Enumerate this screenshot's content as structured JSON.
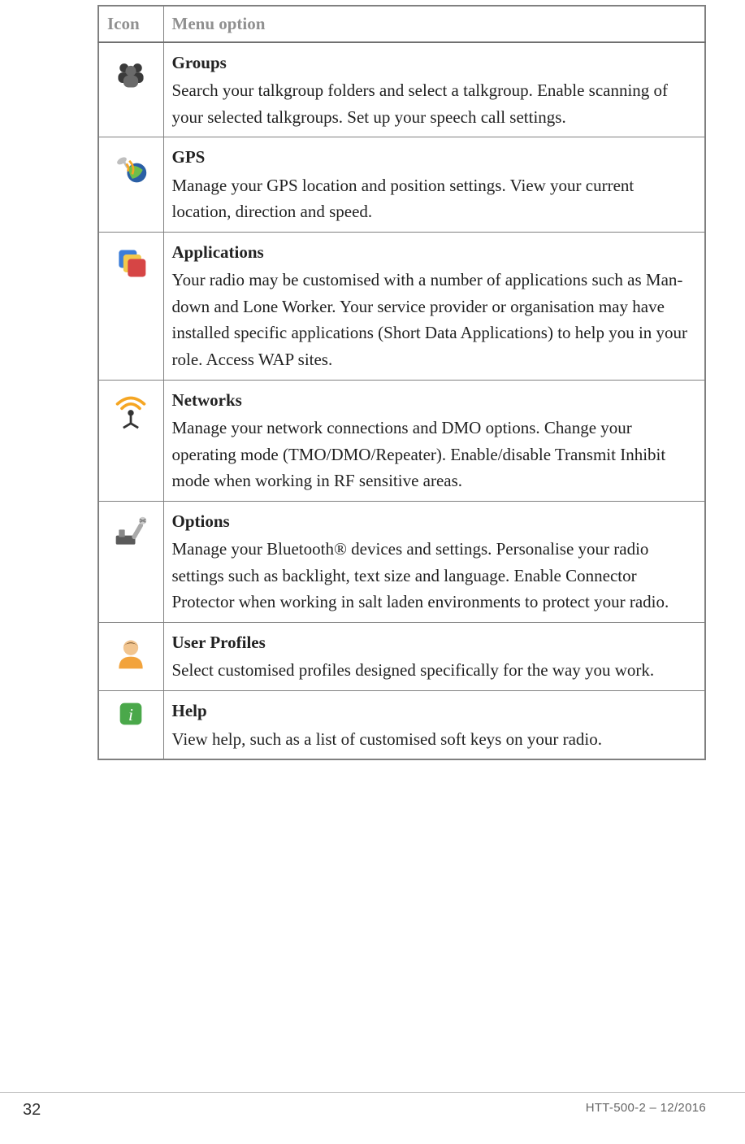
{
  "table": {
    "headers": {
      "icon": "Icon",
      "menu": "Menu option"
    },
    "rows": [
      {
        "icon": "groups-icon",
        "title": "Groups",
        "desc": "Search your talkgroup folders and select a talkgroup. Enable scanning of your selected talkgroups. Set up your speech call settings."
      },
      {
        "icon": "gps-icon",
        "title": "GPS",
        "desc": "Manage your GPS location and position settings. View your current location, direction and speed."
      },
      {
        "icon": "applications-icon",
        "title": "Applications",
        "desc": "Your radio may be customised with a number of applications such as Man-down and Lone Worker. Your service provider or organisation may have installed specific applications (Short Data Applications) to help you in your role. Access WAP sites."
      },
      {
        "icon": "networks-icon",
        "title": "Networks",
        "desc": "Manage your network connections and DMO options. Change your operating mode (TMO/DMO/Repeater). Enable/disable Transmit Inhibit mode when working in RF sensitive areas."
      },
      {
        "icon": "options-icon",
        "title": "Options",
        "desc": "Manage your Bluetooth® devices and settings. Personalise your radio settings such as backlight, text size and language. Enable Connector Protector when working in salt laden environments to protect your radio."
      },
      {
        "icon": "user-profiles-icon",
        "title": "User Profiles",
        "desc": "Select customised profiles designed specifically for the way you work."
      },
      {
        "icon": "help-icon",
        "title": "Help",
        "desc": "View help, such as a list of customised soft keys on your radio."
      }
    ]
  },
  "footer": {
    "page_number": "32",
    "doc_id": "HTT-500-2 – 12/2016"
  }
}
